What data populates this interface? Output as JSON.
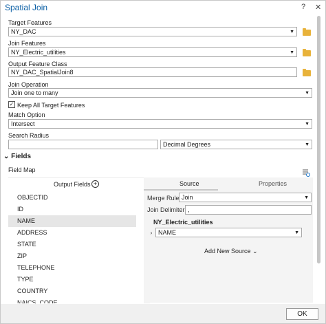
{
  "window": {
    "title": "Spatial Join",
    "help": "?",
    "close": "✕"
  },
  "target_features": {
    "label": "Target Features",
    "value": "NY_DAC"
  },
  "join_features": {
    "label": "Join Features",
    "value": "NY_Electric_utilities"
  },
  "output_feature_class": {
    "label": "Output Feature Class",
    "value": "NY_DAC_SpatialJoin8"
  },
  "join_operation": {
    "label": "Join Operation",
    "value": "Join one to many"
  },
  "keep_all": {
    "label": "Keep All Target Features",
    "checked": true,
    "mark": "✓"
  },
  "match_option": {
    "label": "Match Option",
    "value": "Intersect"
  },
  "search_radius": {
    "label": "Search Radius",
    "value": "",
    "unit": "Decimal Degrees"
  },
  "fields_section": {
    "chevron": "⌄",
    "label": "Fields"
  },
  "field_map": {
    "label": "Field Map",
    "output_fields_header": "Output Fields",
    "add_symbol": "+",
    "fields": [
      "OBJECTID",
      "ID",
      "NAME",
      "ADDRESS",
      "STATE",
      "ZIP",
      "TELEPHONE",
      "TYPE",
      "COUNTRY",
      "NAICS_CODE"
    ],
    "selected_index": 2,
    "tabs": {
      "source": "Source",
      "properties": "Properties"
    },
    "merge_rule": {
      "label": "Merge Rule",
      "value": "Join"
    },
    "join_delimiter": {
      "label": "Join Delimiter",
      "value": ","
    },
    "source_layer": "NY_Electric_utilities",
    "source_field": {
      "expander": "›",
      "value": "NAME"
    },
    "add_new_source": "Add New Source ⌄"
  },
  "footer": {
    "ok_label": "OK"
  },
  "icons": {
    "folder": "folder-icon",
    "dropdown": "▼",
    "fieldmap": "fieldmap-settings-icon"
  }
}
